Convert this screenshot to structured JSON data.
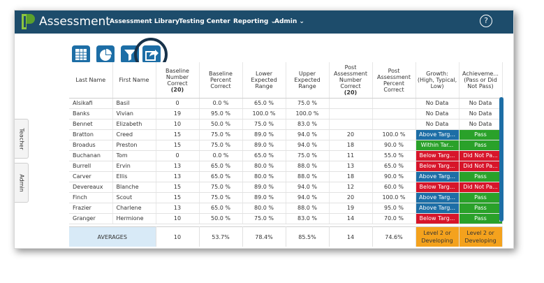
{
  "app": {
    "title": "Assessment"
  },
  "nav": {
    "library": "Assessment Library",
    "testing": "Testing Center",
    "reporting": "Reporting",
    "admin": "Admin"
  },
  "help": {
    "label": "?"
  },
  "side_tabs": {
    "teacher": "Teacher",
    "admin": "Admin"
  },
  "colors": {
    "topbar": "#1d4c6b",
    "accent_blue": "#1d6ea6",
    "pass_green": "#2aa12a",
    "fail_red": "#d7152a",
    "developing_orange": "#f4a21d"
  },
  "table": {
    "headers": {
      "last": "Last Name",
      "first": "First Name",
      "baseline_number": "Baseline Number Correct",
      "baseline_number_total": "(20)",
      "baseline_percent": "Baseline Percent Correct",
      "lower": "Lower Expected Range",
      "upper": "Upper Expected Range",
      "post_number": "Post Assessment Number Correct",
      "post_number_total": "(20)",
      "post_percent": "Post Assessment Percent Correct",
      "growth": "Growth: (High, Typical, Low)",
      "achievement": "Achieveme... (Pass or Did Not Pass)"
    },
    "rows": [
      {
        "last": "Alsikafi",
        "first": "Basil",
        "base_n": "0",
        "base_p": "0.0 %",
        "lower": "65.0 %",
        "upper": "75.0 %",
        "post_n": "",
        "post_p": "",
        "growth": "No Data",
        "ach": "No Data"
      },
      {
        "last": "Banks",
        "first": "Vivian",
        "base_n": "19",
        "base_p": "95.0 %",
        "lower": "100.0 %",
        "upper": "100.0 %",
        "post_n": "",
        "post_p": "",
        "growth": "No Data",
        "ach": "No Data"
      },
      {
        "last": "Bennet",
        "first": "Elizabeth",
        "base_n": "10",
        "base_p": "50.0 %",
        "lower": "75.0 %",
        "upper": "83.0 %",
        "post_n": "",
        "post_p": "",
        "growth": "No Data",
        "ach": "No Data"
      },
      {
        "last": "Bratton",
        "first": "Creed",
        "base_n": "15",
        "base_p": "75.0 %",
        "lower": "89.0 %",
        "upper": "94.0 %",
        "post_n": "20",
        "post_p": "100.0 %",
        "growth": "Above Targ...",
        "ach": "Pass"
      },
      {
        "last": "Broadus",
        "first": "Preston",
        "base_n": "15",
        "base_p": "75.0 %",
        "lower": "89.0 %",
        "upper": "94.0 %",
        "post_n": "18",
        "post_p": "90.0 %",
        "growth": "Within Tar...",
        "ach": "Pass"
      },
      {
        "last": "Buchanan",
        "first": "Tom",
        "base_n": "0",
        "base_p": "0.0 %",
        "lower": "65.0 %",
        "upper": "75.0 %",
        "post_n": "11",
        "post_p": "55.0 %",
        "growth": "Below Targ...",
        "ach": "Did Not Pa..."
      },
      {
        "last": "Burrell",
        "first": "Ervin",
        "base_n": "13",
        "base_p": "65.0 %",
        "lower": "80.0 %",
        "upper": "88.0 %",
        "post_n": "13",
        "post_p": "65.0 %",
        "growth": "Below Targ...",
        "ach": "Did Not Pa..."
      },
      {
        "last": "Carver",
        "first": "Ellis",
        "base_n": "13",
        "base_p": "65.0 %",
        "lower": "80.0 %",
        "upper": "88.0 %",
        "post_n": "18",
        "post_p": "90.0 %",
        "growth": "Above Targ...",
        "ach": "Pass"
      },
      {
        "last": "Devereaux",
        "first": "Blanche",
        "base_n": "15",
        "base_p": "75.0 %",
        "lower": "89.0 %",
        "upper": "94.0 %",
        "post_n": "12",
        "post_p": "60.0 %",
        "growth": "Below Targ...",
        "ach": "Did Not Pa..."
      },
      {
        "last": "Finch",
        "first": "Scout",
        "base_n": "15",
        "base_p": "75.0 %",
        "lower": "89.0 %",
        "upper": "94.0 %",
        "post_n": "20",
        "post_p": "100.0 %",
        "growth": "Above Targ...",
        "ach": "Pass"
      },
      {
        "last": "Frazier",
        "first": "Charlene",
        "base_n": "13",
        "base_p": "65.0 %",
        "lower": "80.0 %",
        "upper": "88.0 %",
        "post_n": "19",
        "post_p": "95.0 %",
        "growth": "Above Targ...",
        "ach": "Pass"
      },
      {
        "last": "Granger",
        "first": "Hermione",
        "base_n": "10",
        "base_p": "50.0 %",
        "lower": "75.0 %",
        "upper": "83.0 %",
        "post_n": "14",
        "post_p": "70.0 %",
        "growth": "Below Targ...",
        "ach": "Pass"
      }
    ]
  },
  "averages": {
    "label": "AVERAGES",
    "base_n": "10",
    "base_p": "53.7%",
    "lower": "78.4%",
    "upper": "85.5%",
    "post_n": "14",
    "post_p": "74.6%",
    "growth": "Level 2 or Developing",
    "ach": "Level 2 or Developing"
  }
}
